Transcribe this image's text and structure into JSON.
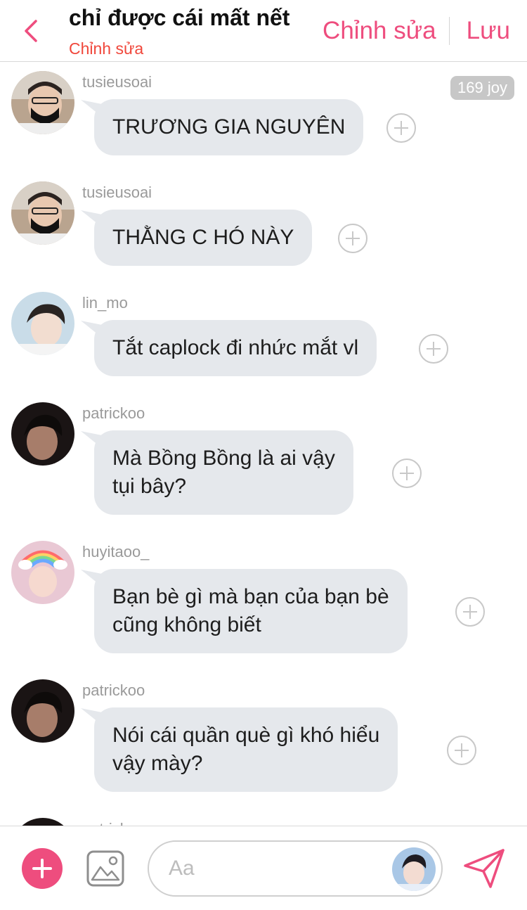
{
  "header": {
    "title": "chỉ được cái mất nết",
    "subtitle": "Chỉnh sửa",
    "edit_label": "Chỉnh sửa",
    "save_label": "Lưu",
    "accent_color": "#ee4d7e",
    "subtitle_color": "#f0473b"
  },
  "joy_badge": "169 joy",
  "messages": [
    {
      "username": "tusieusoai",
      "lines": [
        "TRƯƠNG GIA NGUYÊN"
      ],
      "avatar_icon": "user-avatar-icon"
    },
    {
      "username": "tusieusoai",
      "lines": [
        "THẰNG C HÓ NÀY"
      ],
      "avatar_icon": "user-avatar-icon"
    },
    {
      "username": "lin_mo",
      "lines": [
        "Tắt caplock đi nhức mắt vl"
      ],
      "avatar_icon": "user-avatar-icon"
    },
    {
      "username": "patrickoo",
      "lines": [
        "Mà Bồng Bồng là ai vậy",
        "tụi bây?"
      ],
      "avatar_icon": "user-avatar-icon"
    },
    {
      "username": "huyitaoo_",
      "lines": [
        "Bạn bè gì mà bạn của bạn bè",
        "cũng không biết"
      ],
      "avatar_icon": "user-avatar-icon"
    },
    {
      "username": "patrickoo",
      "lines": [
        "Nói cái quần què gì khó hiểu",
        "vậy mày?"
      ],
      "avatar_icon": "user-avatar-icon"
    },
    {
      "username": "patrickoo",
      "lines": [],
      "avatar_icon": "user-avatar-icon"
    }
  ],
  "composer": {
    "placeholder": "Aa",
    "plus_icon": "plus-icon",
    "image_icon": "image-icon",
    "send_icon": "send-icon"
  },
  "colors": {
    "bubble": "#e5e8ec",
    "username": "#9a9a9a"
  }
}
